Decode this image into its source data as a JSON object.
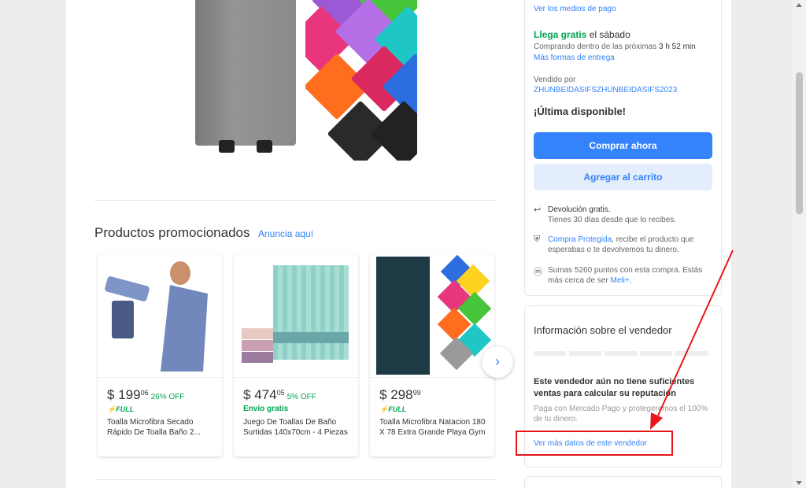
{
  "hero": {
    "image": "towel-product-photo"
  },
  "promoted": {
    "title": "Productos promocionados",
    "advertise_link": "Anuncia aquí",
    "items": [
      {
        "currency": "$",
        "price": "199",
        "cents": "06",
        "discount": "26% OFF",
        "shipping": "",
        "full": "FULL",
        "name": "Toalla Microfibra Secado Rápido De Toalla Baño 2..."
      },
      {
        "currency": "$",
        "price": "474",
        "cents": "05",
        "discount": "5% OFF",
        "shipping": "Envío gratis",
        "full": "",
        "name": "Juego De Toallas De Baño Surtidas 140x70cm - 4 Piezas"
      },
      {
        "currency": "$",
        "price": "298",
        "cents": "99",
        "discount": "",
        "shipping": "",
        "full": "FULL",
        "name": "Toalla Microfibra Natacion 180 X 78 Extra Grande Playa Gym"
      }
    ],
    "next_icon": "›"
  },
  "buybox": {
    "payment_link": "Ver los medios de pago",
    "delivery_strong": "Llega gratis",
    "delivery_day": " el sábado",
    "delivery_time_prefix": "Comprando dentro de las próximas ",
    "delivery_time": "3 h 52 min",
    "delivery_more": "Más formas de entrega",
    "sold_by_label": "Vendido por",
    "seller_name": "ZHUNBEIDASIFSZHUNBEIDASIFS2023",
    "stock": "¡Última disponible!",
    "buy_now": "Comprar ahora",
    "add_to_cart": "Agregar al carrito",
    "return_link": "Devolución gratis.",
    "return_text": "Tienes 30 días desde que lo recibes.",
    "protected_link": "Compra Protegida",
    "protected_text": ", recibe el producto que",
    "protected_text2": "esperabas o te devolvemos tu dinero.",
    "points_text": "Sumas 5260 puntos con esta compra. Estás",
    "points_text2": "más cerca de ser ",
    "points_link": "Meli+."
  },
  "seller": {
    "title": "Información sobre el vendedor",
    "no_reputation": "Este vendedor aún no tiene suficientes ventas para calcular su reputación",
    "guarantee": "Paga con Mercado Pago y protegeremos el 100% de tu dinero.",
    "more_link": "Ver más datos de este vendedor"
  },
  "colors": {
    "accent": "#3483fa",
    "green": "#00a650",
    "annotation": "#e8161b"
  }
}
